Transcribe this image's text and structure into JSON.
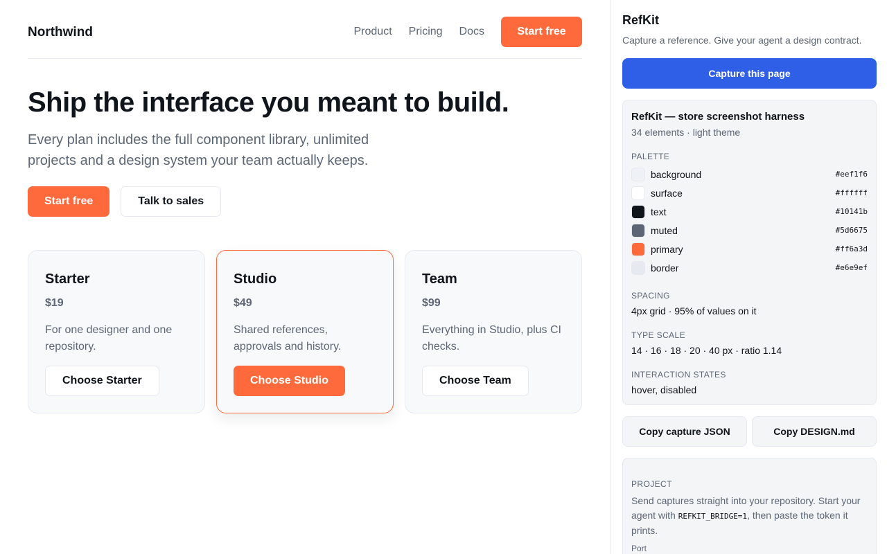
{
  "nav": {
    "brand": "Northwind",
    "links": [
      "Product",
      "Pricing",
      "Docs"
    ],
    "cta": "Start free"
  },
  "hero": {
    "title": "Ship the interface you meant to build.",
    "subtitle": "Every plan includes the full component library, unlimited projects and a design system your team actually keeps.",
    "primary_cta": "Start free",
    "secondary_cta": "Talk to sales"
  },
  "plans": [
    {
      "name": "Starter",
      "price": "$19",
      "description": "For one designer and one repository.",
      "cta": "Choose Starter",
      "featured": false
    },
    {
      "name": "Studio",
      "price": "$49",
      "description": "Shared references, approvals and history.",
      "cta": "Choose Studio",
      "featured": true
    },
    {
      "name": "Team",
      "price": "$99",
      "description": "Everything in Studio, plus CI checks.",
      "cta": "Choose Team",
      "featured": false
    }
  ],
  "panel": {
    "title": "RefKit",
    "subtitle": "Capture a reference. Give your agent a design contract.",
    "capture_button": "Capture this page",
    "summary": {
      "title": "RefKit — store screenshot harness",
      "meta": "34 elements · light theme",
      "palette_label": "PALETTE",
      "palette": [
        {
          "name": "background",
          "hex": "#eef1f6"
        },
        {
          "name": "surface",
          "hex": "#ffffff"
        },
        {
          "name": "text",
          "hex": "#10141b"
        },
        {
          "name": "muted",
          "hex": "#5d6675"
        },
        {
          "name": "primary",
          "hex": "#ff6a3d"
        },
        {
          "name": "border",
          "hex": "#e6e9ef"
        }
      ],
      "spacing_label": "SPACING",
      "spacing_value": "4px grid · 95% of values on it",
      "type_label": "TYPE SCALE",
      "type_value": "14 · 16 · 18 · 20 · 40 px · ratio 1.14",
      "states_label": "INTERACTION STATES",
      "states_value": "hover, disabled"
    },
    "copy_json": "Copy capture JSON",
    "copy_design": "Copy DESIGN.md",
    "project": {
      "label": "PROJECT",
      "text_before": "Send captures straight into your repository. Start your agent with ",
      "code": "REFKIT_BRIDGE=1",
      "text_after": ", then paste the token it prints.",
      "port_label": "Port"
    }
  }
}
